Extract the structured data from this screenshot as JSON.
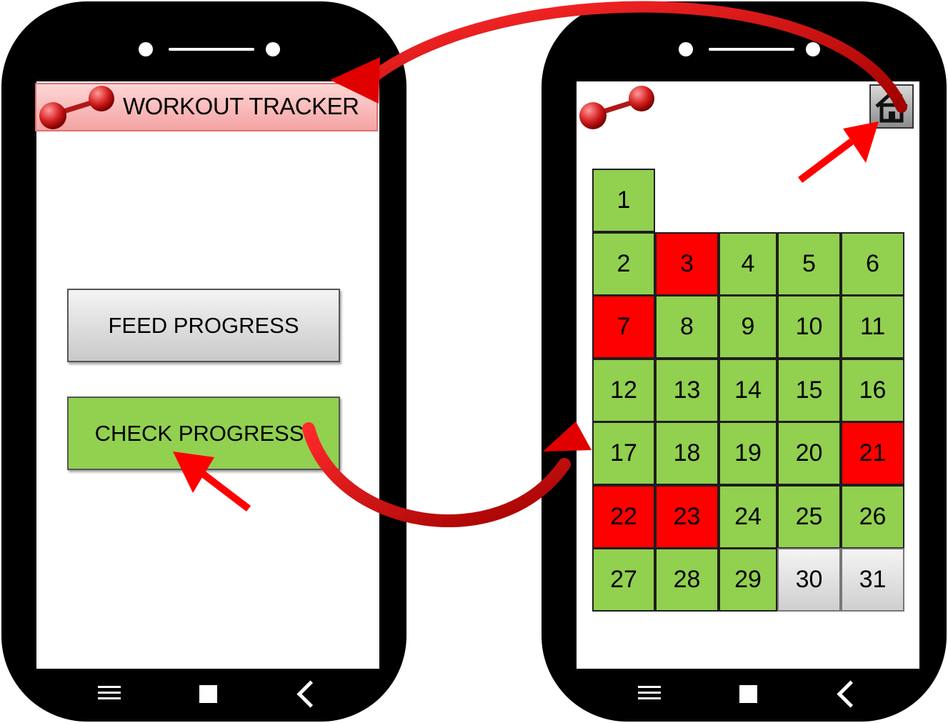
{
  "left_screen": {
    "title": "WORKOUT TRACKER",
    "feed_button": "FEED PROGRESS",
    "check_button": "CHECK PROGRESS"
  },
  "right_screen": {
    "home_icon": "home-icon",
    "days": [
      {
        "label": "1",
        "status": "done"
      },
      {
        "label": "2",
        "status": "done"
      },
      {
        "label": "3",
        "status": "missed"
      },
      {
        "label": "4",
        "status": "done"
      },
      {
        "label": "5",
        "status": "done"
      },
      {
        "label": "6",
        "status": "done"
      },
      {
        "label": "7",
        "status": "missed"
      },
      {
        "label": "8",
        "status": "done"
      },
      {
        "label": "9",
        "status": "done"
      },
      {
        "label": "10",
        "status": "done"
      },
      {
        "label": "11",
        "status": "done"
      },
      {
        "label": "12",
        "status": "done"
      },
      {
        "label": "13",
        "status": "done"
      },
      {
        "label": "14",
        "status": "done"
      },
      {
        "label": "15",
        "status": "done"
      },
      {
        "label": "16",
        "status": "done"
      },
      {
        "label": "17",
        "status": "done"
      },
      {
        "label": "18",
        "status": "done"
      },
      {
        "label": "19",
        "status": "done"
      },
      {
        "label": "20",
        "status": "done"
      },
      {
        "label": "21",
        "status": "missed"
      },
      {
        "label": "22",
        "status": "missed"
      },
      {
        "label": "23",
        "status": "missed"
      },
      {
        "label": "24",
        "status": "done"
      },
      {
        "label": "25",
        "status": "done"
      },
      {
        "label": "26",
        "status": "done"
      },
      {
        "label": "27",
        "status": "done"
      },
      {
        "label": "28",
        "status": "done"
      },
      {
        "label": "29",
        "status": "done"
      },
      {
        "label": "30",
        "status": "future"
      },
      {
        "label": "31",
        "status": "future"
      }
    ]
  },
  "nav_icons": [
    "menu-icon",
    "square-icon",
    "back-icon"
  ],
  "colors": {
    "done": "#92d050",
    "missed": "#ff0000",
    "future": "#e6e6e6",
    "arrow": "#e00000",
    "header": "#f4a3a3"
  }
}
